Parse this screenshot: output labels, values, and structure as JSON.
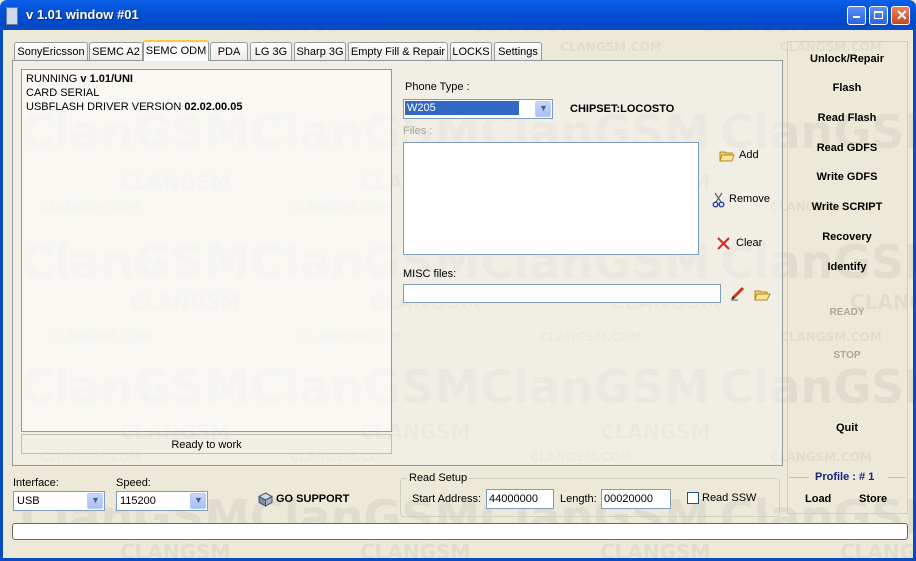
{
  "window": {
    "title": "v 1.01 window #01"
  },
  "tabs": [
    {
      "label": "SonyEricsson"
    },
    {
      "label": "SEMC A2"
    },
    {
      "label": "SEMC ODM",
      "active": true
    },
    {
      "label": "PDA"
    },
    {
      "label": "LG 3G"
    },
    {
      "label": "Sharp 3G"
    },
    {
      "label": "Empty Fill & Repair"
    },
    {
      "label": "LOCKS"
    },
    {
      "label": "Settings"
    }
  ],
  "log": {
    "line1_prefix": "RUNNING ",
    "line1_value": "v 1.01/UNI",
    "line2": "CARD SERIAL",
    "line3_prefix": "USBFLASH DRIVER VERSION ",
    "line3_value": "02.02.00.05"
  },
  "status": {
    "text": "Ready to work"
  },
  "phone": {
    "label": "Phone Type :",
    "value": "W205",
    "chipset": "CHIPSET:LOCOSTO"
  },
  "files": {
    "label": "Files :",
    "add": "Add",
    "remove": "Remove",
    "clear": "Clear"
  },
  "misc": {
    "label": "MISC files:",
    "value": ""
  },
  "interface": {
    "label": "Interface:",
    "value": "USB"
  },
  "speed": {
    "label": "Speed:",
    "value": "115200"
  },
  "support": {
    "label": "GO SUPPORT"
  },
  "read_setup": {
    "title": "Read Setup",
    "start_label": "Start Address:",
    "start_value": "44000000",
    "length_label": "Length:",
    "length_value": "00020000",
    "ssw_label": "Read SSW"
  },
  "actions": [
    {
      "label": "Unlock/Repair",
      "enabled": true
    },
    {
      "label": "Flash",
      "enabled": true
    },
    {
      "label": "Read Flash",
      "enabled": true
    },
    {
      "label": "Read GDFS",
      "enabled": true
    },
    {
      "label": "Write GDFS",
      "enabled": true
    },
    {
      "label": "Write SCRIPT",
      "enabled": true
    },
    {
      "label": "Recovery",
      "enabled": true
    },
    {
      "label": "Identify",
      "enabled": true
    },
    {
      "label": "READY",
      "enabled": false
    },
    {
      "label": "STOP",
      "enabled": false
    },
    {
      "label": "Quit",
      "enabled": true
    }
  ],
  "profile": {
    "label": "Profile : ",
    "value": "# 1",
    "load": "Load",
    "store": "Store"
  },
  "watermark": {
    "big": "ClanGSM",
    "mid": "CLANGSM",
    "small": "CLANGSM.COM"
  },
  "progress": {
    "value": 0
  },
  "colors": {
    "titlebar": "#0351d6",
    "face": "#ece9d8",
    "selection": "#316ac5",
    "profile_text": "#1a237e",
    "tab_active_border": "#ffc83c"
  }
}
